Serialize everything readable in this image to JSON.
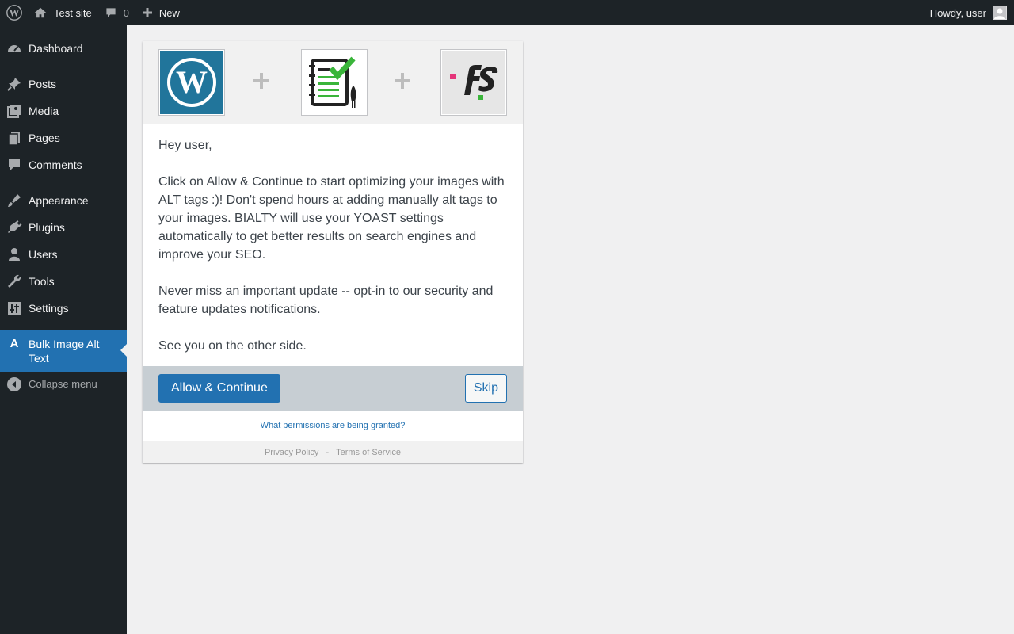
{
  "adminbar": {
    "site_name": "Test site",
    "comments_count": "0",
    "new_label": "New",
    "greeting": "Howdy, user"
  },
  "sidebar": {
    "items": [
      {
        "label": "Dashboard",
        "icon": "dashboard-icon"
      },
      {
        "label": "Posts",
        "icon": "pin-icon"
      },
      {
        "label": "Media",
        "icon": "media-icon"
      },
      {
        "label": "Pages",
        "icon": "pages-icon"
      },
      {
        "label": "Comments",
        "icon": "comment-icon"
      },
      {
        "label": "Appearance",
        "icon": "brush-icon"
      },
      {
        "label": "Plugins",
        "icon": "plug-icon"
      },
      {
        "label": "Users",
        "icon": "user-icon"
      },
      {
        "label": "Tools",
        "icon": "wrench-icon"
      },
      {
        "label": "Settings",
        "icon": "settings-icon"
      }
    ],
    "current": {
      "label": "Bulk Image Alt Text",
      "icon_letter": "A"
    },
    "collapse_label": "Collapse menu"
  },
  "connect": {
    "greeting": "Hey user,",
    "paragraph1": "Click on Allow & Continue to start optimizing your images with ALT tags :)! Don't spend hours at adding manually alt tags to your images. BIALTY will use your YOAST settings automatically to get better results on search engines and improve your SEO.",
    "paragraph2": "Never miss an important update -- opt-in to our security and feature updates notifications.",
    "paragraph3": "See you on the other side.",
    "allow_label": "Allow & Continue ",
    "skip_label": "Skip",
    "permissions_link": "What permissions are being granted?",
    "privacy_link": "Privacy Policy",
    "separator": "-",
    "terms_link": "Terms of Service"
  },
  "colors": {
    "adminbar_bg": "#1d2327",
    "accent": "#2271b1",
    "page_bg": "#f0f0f1"
  }
}
